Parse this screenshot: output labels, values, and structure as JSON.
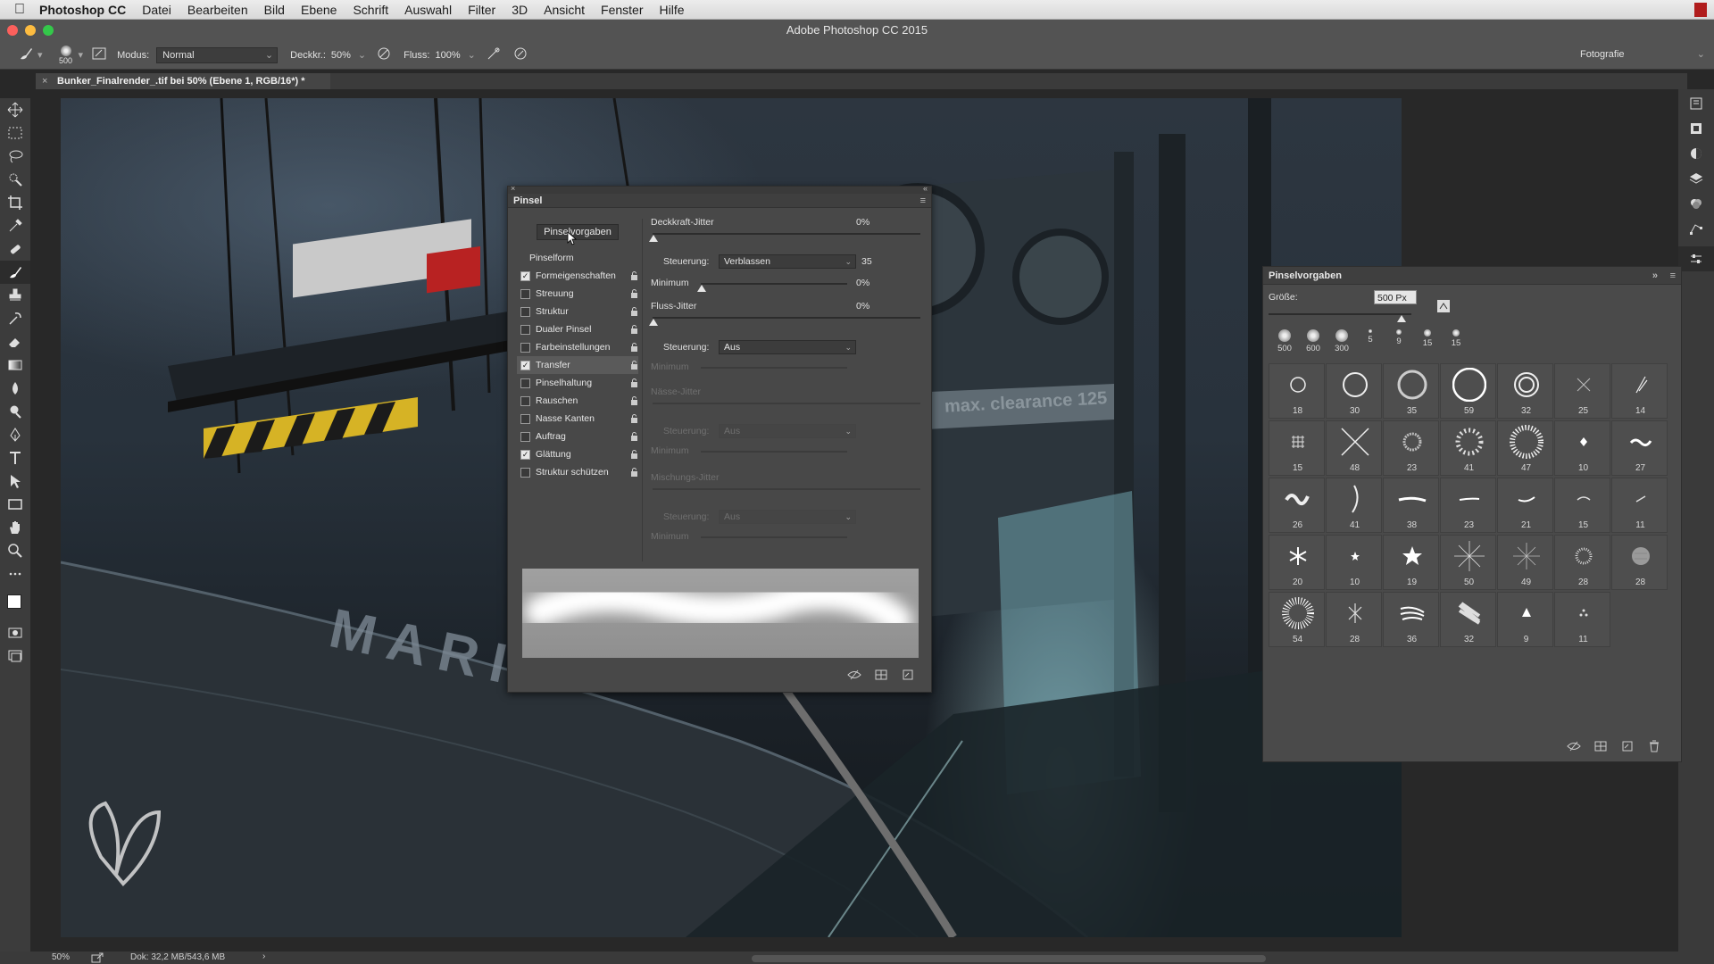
{
  "menubar": {
    "app": "Photoshop CC",
    "items": [
      "Datei",
      "Bearbeiten",
      "Bild",
      "Ebene",
      "Schrift",
      "Auswahl",
      "Filter",
      "3D",
      "Ansicht",
      "Fenster",
      "Hilfe"
    ]
  },
  "window": {
    "title": "Adobe Photoshop CC 2015"
  },
  "options": {
    "brush_size": "500",
    "modus_label": "Modus:",
    "modus_value": "Normal",
    "deckkr_label": "Deckkr.:",
    "deckkr_value": "50%",
    "fluss_label": "Fluss:",
    "fluss_value": "100%",
    "workspace": "Fotografie"
  },
  "document": {
    "tab": "Bunker_Finalrender_.tif bei 50% (Ebene 1, RGB/16*) *"
  },
  "canvas": {
    "painted_text_marine": "MARI",
    "painted_text_clearance": "max. clearance 125"
  },
  "status": {
    "zoom": "50%",
    "doc": "Dok: 32,2 MB/543,6 MB",
    "arrow": "›"
  },
  "pinsel": {
    "title": "Pinsel",
    "presets_button": "Pinselvorgaben",
    "options": [
      {
        "label": "Pinselform",
        "type": "header"
      },
      {
        "label": "Formeigenschaften",
        "checked": true
      },
      {
        "label": "Streuung",
        "checked": false
      },
      {
        "label": "Struktur",
        "checked": false
      },
      {
        "label": "Dualer Pinsel",
        "checked": false
      },
      {
        "label": "Farbeinstellungen",
        "checked": false
      },
      {
        "label": "Transfer",
        "checked": true,
        "active": true
      },
      {
        "label": "Pinselhaltung",
        "checked": false
      },
      {
        "label": "Rauschen",
        "checked": false
      },
      {
        "label": "Nasse Kanten",
        "checked": false
      },
      {
        "label": "Auftrag",
        "checked": false
      },
      {
        "label": "Glättung",
        "checked": true
      },
      {
        "label": "Struktur schützen",
        "checked": false
      }
    ],
    "deckkraft_jitter_label": "Deckkraft-Jitter",
    "deckkraft_jitter_value": "0%",
    "steuerung_label": "Steuerung:",
    "steuerung1_value": "Verblassen",
    "steuerung1_number": "35",
    "minimum_label": "Minimum",
    "minimum1_value": "0%",
    "fluss_jitter_label": "Fluss-Jitter",
    "fluss_jitter_value": "0%",
    "steuerung2_value": "Aus",
    "naesse_jitter_label": "Nässe-Jitter",
    "steuerung3_value": "Aus",
    "mischungs_jitter_label": "Mischungs-Jitter",
    "steuerung4_value": "Aus"
  },
  "vorgaben": {
    "title": "Pinselvorgaben",
    "size_label": "Größe:",
    "size_value": "500 Px",
    "recent": [
      "500",
      "600",
      "300",
      "5",
      "9",
      "15",
      "15"
    ],
    "grid_values": [
      "18",
      "30",
      "35",
      "59",
      "32",
      "25",
      "14",
      "15",
      "48",
      "23",
      "41",
      "47",
      "10",
      "27",
      "26",
      "41",
      "38",
      "23",
      "21",
      "15",
      "11",
      "20",
      "10",
      "19",
      "50",
      "49",
      "28",
      "28",
      "54",
      "28",
      "36",
      "32",
      "9",
      "11"
    ]
  },
  "colors": {
    "accent": "#535353",
    "panel": "#4a4a4a",
    "menubar": "#e6e6e6"
  }
}
